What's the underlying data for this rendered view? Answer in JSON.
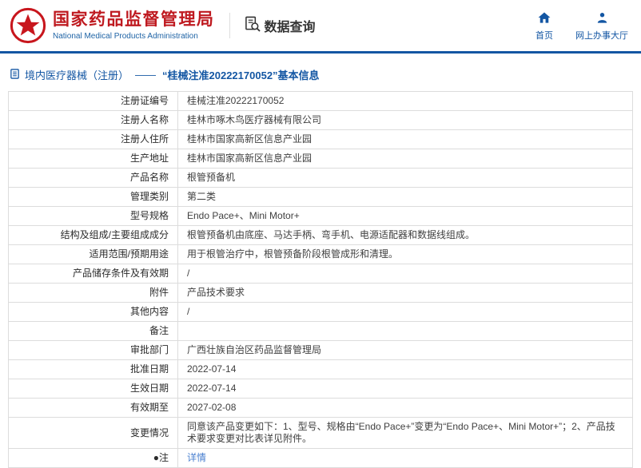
{
  "colors": {
    "accent_red": "#bf1a20",
    "accent_blue": "#1356a3",
    "link_blue": "#4a80d0",
    "border_gray": "#dcdcdc"
  },
  "header": {
    "agency_cn": "国家药品监督管理局",
    "agency_en": "National Medical Products Administration",
    "nav_data_query": "数据查询",
    "nav_home": "首页",
    "nav_service_hall": "网上办事大厅"
  },
  "breadcrumb": {
    "section": "境内医疗器械（注册）",
    "separator": "——",
    "title": "“桂械注准20222170052”基本信息"
  },
  "table": {
    "rows": [
      {
        "label": "注册证编号",
        "value": "桂械注准20222170052"
      },
      {
        "label": "注册人名称",
        "value": "桂林市啄木鸟医疗器械有限公司"
      },
      {
        "label": "注册人住所",
        "value": "桂林市国家高新区信息产业园"
      },
      {
        "label": "生产地址",
        "value": "桂林市国家高新区信息产业园"
      },
      {
        "label": "产品名称",
        "value": "根管预备机"
      },
      {
        "label": "管理类别",
        "value": "第二类"
      },
      {
        "label": "型号规格",
        "value": "Endo Pace+、Mini Motor+"
      },
      {
        "label": "结构及组成/主要组成成分",
        "value": "根管预备机由底座、马达手柄、弯手机、电源适配器和数据线组成。"
      },
      {
        "label": "适用范围/预期用途",
        "value": "用于根管治疗中，根管预备阶段根管成形和清理。"
      },
      {
        "label": "产品储存条件及有效期",
        "value": "/"
      },
      {
        "label": "附件",
        "value": "产品技术要求"
      },
      {
        "label": "其他内容",
        "value": "/"
      },
      {
        "label": "备注",
        "value": ""
      },
      {
        "label": "审批部门",
        "value": "广西壮族自治区药品监督管理局"
      },
      {
        "label": "批准日期",
        "value": "2022-07-14"
      },
      {
        "label": "生效日期",
        "value": "2022-07-14"
      },
      {
        "label": "有效期至",
        "value": "2027-02-08"
      },
      {
        "label": "变更情况",
        "value": "同意该产品变更如下：1、型号、规格由“Endo Pace+”变更为“Endo Pace+、Mini Motor+”；2、产品技术要求变更对比表详见附件。"
      },
      {
        "label": "●注",
        "value": "详情"
      }
    ]
  }
}
